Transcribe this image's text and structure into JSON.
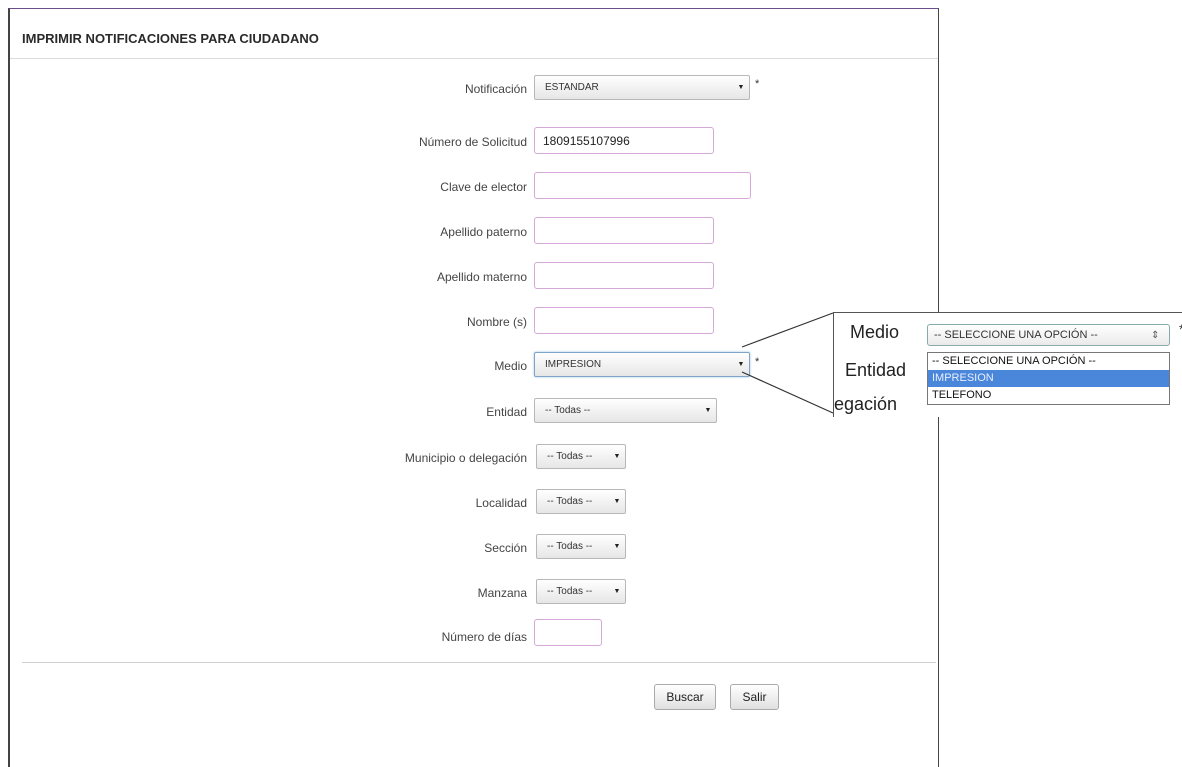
{
  "form": {
    "title": "IMPRIMIR NOTIFICACIONES PARA CIUDADANO",
    "required_mark": "*",
    "fields": {
      "notificacion": {
        "label": "Notificación",
        "value": "ESTANDAR"
      },
      "numero_solicitud": {
        "label": "Número de Solicitud",
        "value": "1809155107996"
      },
      "clave_elector": {
        "label": "Clave de elector",
        "value": ""
      },
      "apellido_paterno": {
        "label": "Apellido paterno",
        "value": ""
      },
      "apellido_materno": {
        "label": "Apellido materno",
        "value": ""
      },
      "nombre": {
        "label": "Nombre (s)",
        "value": ""
      },
      "medio": {
        "label": "Medio",
        "value": "IMPRESION"
      },
      "entidad": {
        "label": "Entidad",
        "value": "-- Todas --"
      },
      "municipio": {
        "label": "Municipio o delegación",
        "value": "-- Todas --"
      },
      "localidad": {
        "label": "Localidad",
        "value": "-- Todas --"
      },
      "seccion": {
        "label": "Sección",
        "value": "-- Todas --"
      },
      "manzana": {
        "label": "Manzana",
        "value": "-- Todas --"
      },
      "numero_dias": {
        "label": "Número de días",
        "value": ""
      }
    },
    "buttons": {
      "buscar": "Buscar",
      "salir": "Salir"
    }
  },
  "zoom": {
    "medio_label": "Medio",
    "entidad_label": "Entidad",
    "delegacion_label": "legación",
    "selected": "-- SELECCIONE UNA OPCIÓN --",
    "required_mark": "*",
    "options": [
      "-- SELECCIONE UNA OPCIÓN --",
      "IMPRESION",
      "TELEFONO"
    ],
    "highlighted_option": "IMPRESION"
  },
  "icons": {
    "select_arrow": "dropdown-arrow-icon",
    "spinner": "updown-arrows-icon"
  }
}
